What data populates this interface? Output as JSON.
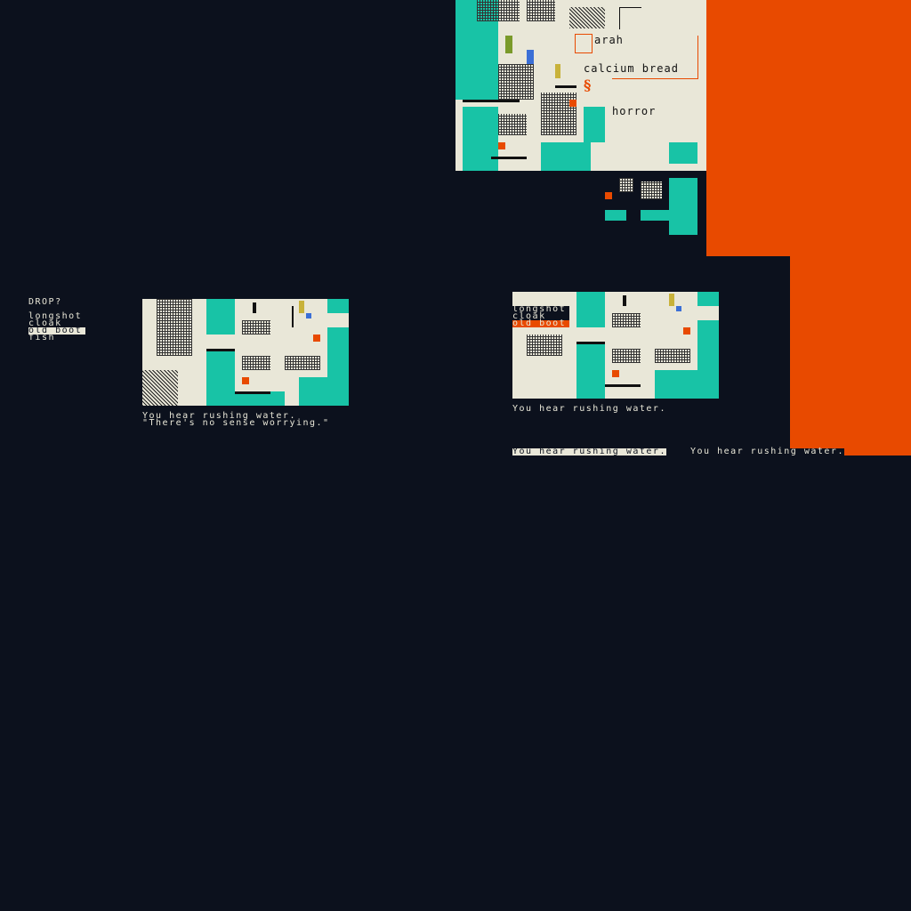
{
  "colors": {
    "background": "#0c111d",
    "cream": "#e9e7d8",
    "teal": "#18c3a6",
    "orange": "#e84a00"
  },
  "sprite_sheet": {
    "name_label": "arah",
    "food_label": "calcium bread",
    "mood_label": "horror"
  },
  "drop_menu": {
    "title": "DROP?",
    "items": [
      {
        "label": "longshot",
        "selected": false
      },
      {
        "label": "cloak",
        "selected": false
      },
      {
        "label": "old boot",
        "selected": true
      },
      {
        "label": "fish",
        "selected": false
      }
    ]
  },
  "scene_left": {
    "messages": [
      "You hear rushing water.",
      "\"There's no sense worrying.\""
    ]
  },
  "scene_right": {
    "menu_items": [
      "longshot",
      "cloak",
      "old boot"
    ],
    "message": "You hear rushing water."
  },
  "bottom_messages": [
    "You hear rushing water.",
    "You hear rushing water."
  ]
}
